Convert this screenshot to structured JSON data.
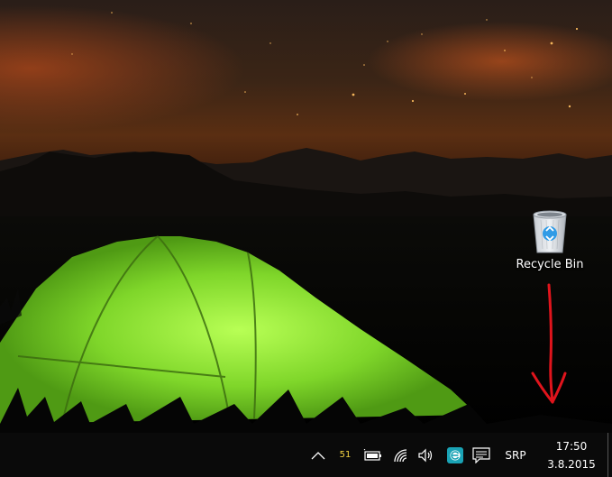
{
  "desktop": {
    "recycle_bin_label": "Recycle Bin"
  },
  "taskbar": {
    "overflow_icon": "chevron-up-icon",
    "temperature": "51",
    "battery_icon": "battery-icon",
    "network_icon": "wifi-icon",
    "volume_icon": "speaker-icon",
    "antivirus_icon": "eset-icon",
    "notifications_icon": "action-center-icon",
    "language": "SRP",
    "time": "17:50",
    "date": "3.8.2015"
  },
  "colors": {
    "taskbar_bg": "#0a0a0a",
    "annotation_red": "#e0141c",
    "tent_green": "#8ee03a",
    "eset_teal": "#1aa3b5"
  }
}
